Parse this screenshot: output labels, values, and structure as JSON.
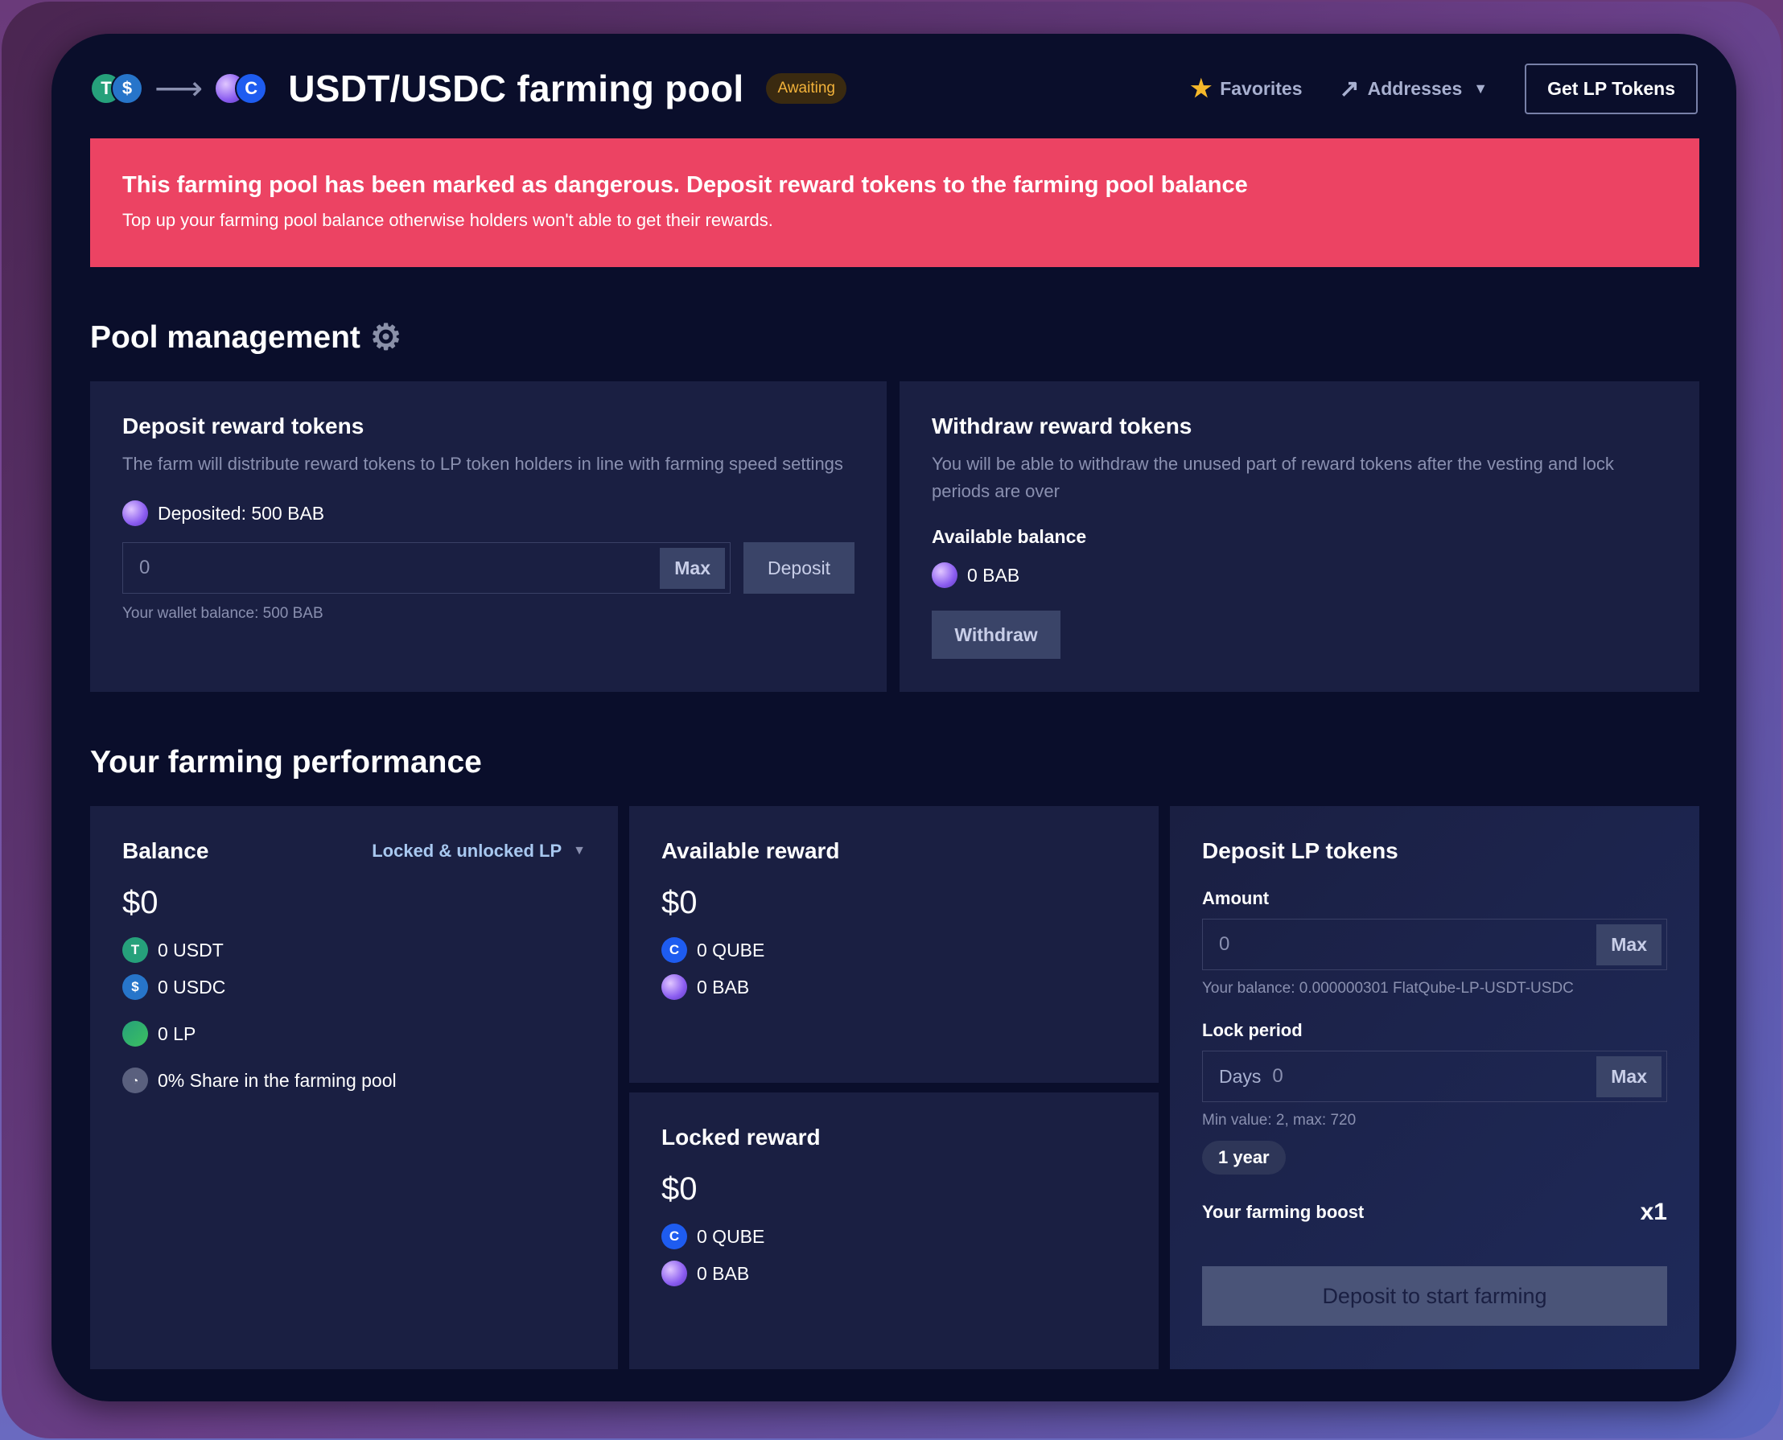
{
  "header": {
    "title": "USDT/USDC farming pool",
    "status_badge": "Awaiting",
    "favorites_label": "Favorites",
    "addresses_label": "Addresses",
    "get_lp_label": "Get LP Tokens",
    "left_tokens": [
      "USDT",
      "USDC"
    ],
    "right_tokens": [
      "BAB",
      "QUBE"
    ]
  },
  "alert": {
    "title": "This farming pool has been marked as dangerous. Deposit reward tokens to the farming pool balance",
    "text": "Top up your farming pool balance otherwise holders won't able to get their rewards.",
    "color": "#ec4363"
  },
  "pool_management": {
    "title": "Pool management",
    "deposit": {
      "title": "Deposit reward tokens",
      "desc": "The farm will distribute reward tokens to LP token holders in line with farming speed settings",
      "deposited": "Deposited: 500 BAB",
      "input_value": "0",
      "max_label": "Max",
      "button_label": "Deposit",
      "wallet_balance": "Your wallet balance: 500 BAB"
    },
    "withdraw": {
      "title": "Withdraw reward tokens",
      "desc": "You will be able to withdraw the unused part of reward tokens after the vesting and lock periods are over",
      "available_label": "Available balance",
      "available_value": "0 BAB",
      "button_label": "Withdraw"
    }
  },
  "performance": {
    "title": "Your farming performance",
    "balance": {
      "title": "Balance",
      "filter": "Locked & unlocked LP",
      "value": "$0",
      "usdt": "0 USDT",
      "usdc": "0 USDC",
      "lp": "0 LP",
      "share": "0% Share in the farming pool"
    },
    "available_reward": {
      "title": "Available reward",
      "value": "$0",
      "qube": "0 QUBE",
      "bab": "0 BAB"
    },
    "locked_reward": {
      "title": "Locked reward",
      "value": "$0",
      "qube": "0 QUBE",
      "bab": "0 BAB"
    },
    "deposit_lp": {
      "title": "Deposit LP tokens",
      "amount_label": "Amount",
      "amount_value": "0",
      "max_label": "Max",
      "balance_note": "Your balance: 0.000000301 FlatQube-LP-USDT-USDC",
      "lock_label": "Lock period",
      "days_label": "Days",
      "days_value": "0",
      "lock_note": "Min value: 2, max: 720",
      "chip_label": "1 year",
      "boost_label": "Your farming boost",
      "boost_value": "x1",
      "button_label": "Deposit to start farming"
    }
  }
}
